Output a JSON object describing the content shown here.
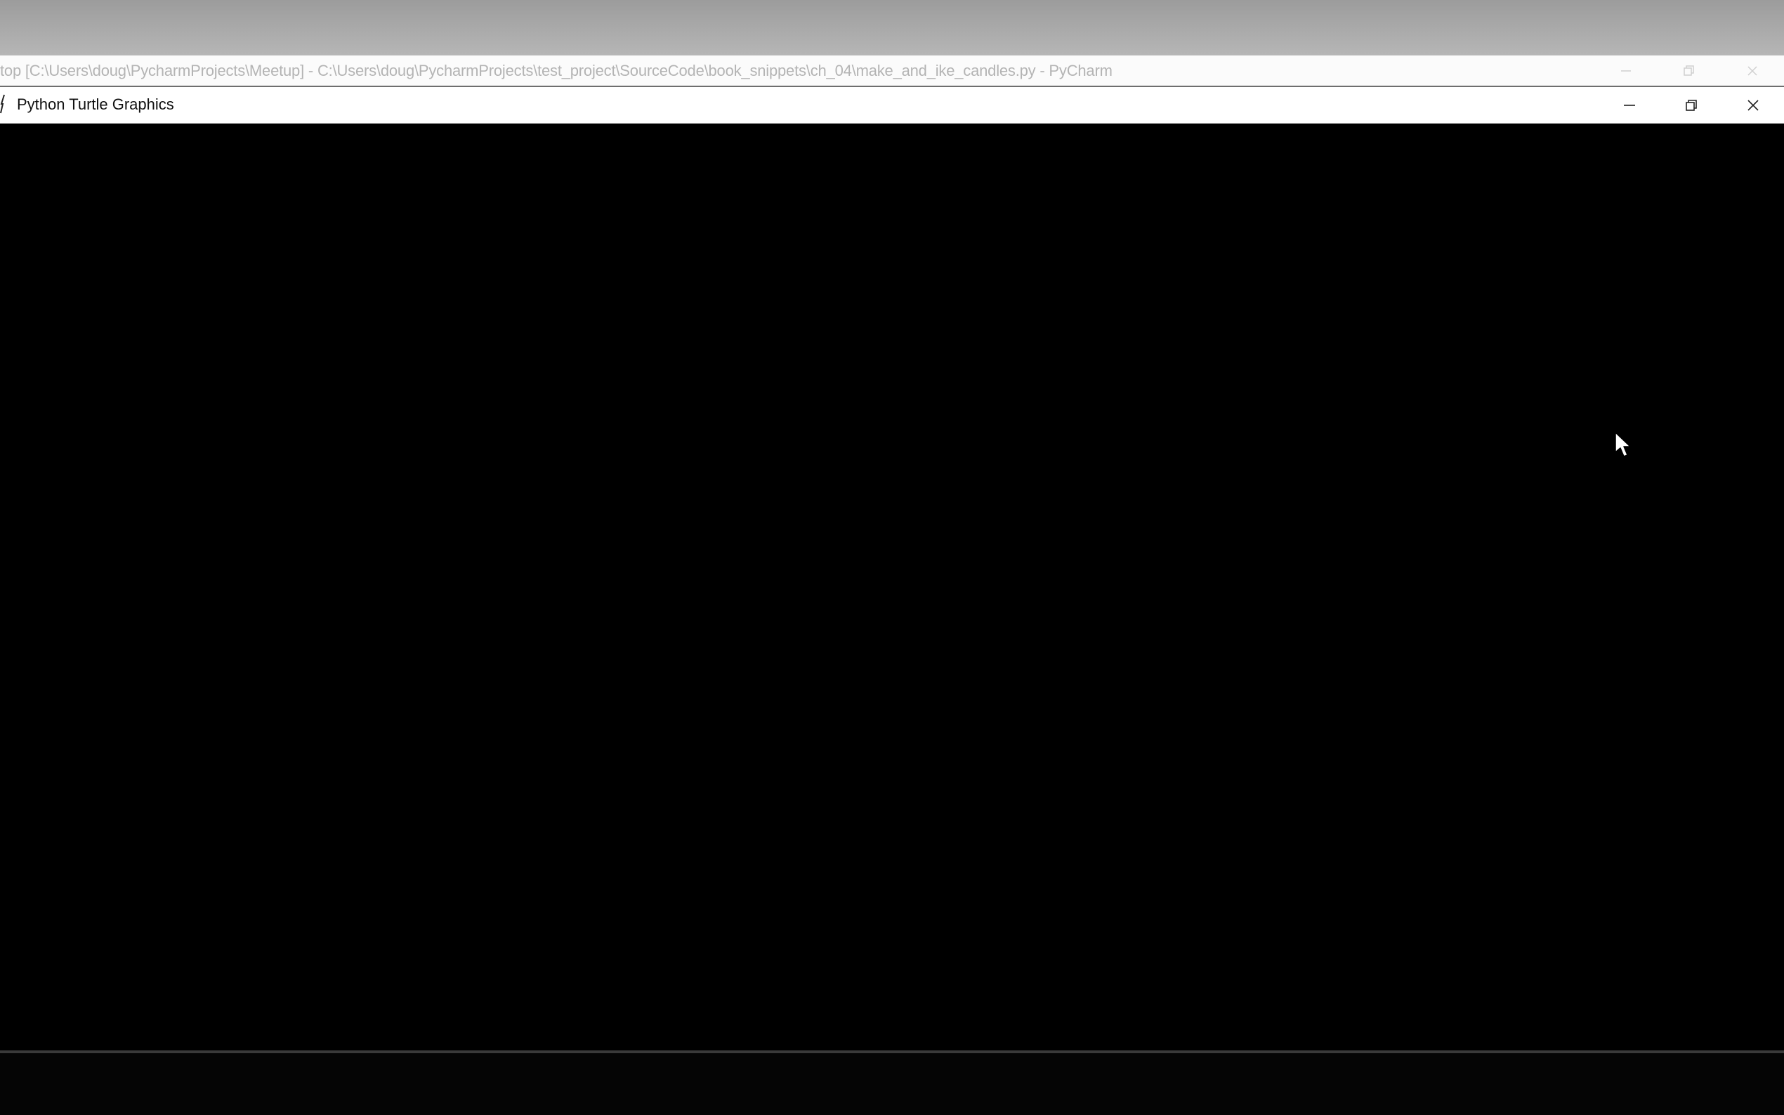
{
  "background_window": {
    "title": "top [C:\\Users\\doug\\PycharmProjects\\Meetup] - C:\\Users\\doug\\PycharmProjects\\test_project\\SourceCode\\book_snippets\\ch_04\\make_and_ike_candles.py - PyCharm",
    "controls": {
      "minimize_icon": "minimize-icon",
      "restore_icon": "restore-icon",
      "close_icon": "close-icon"
    }
  },
  "turtle_window": {
    "title": "Python Turtle Graphics",
    "app_icon": "feather-icon",
    "controls": {
      "minimize_icon": "minimize-icon",
      "restore_icon": "restore-icon",
      "close_icon": "close-icon"
    },
    "canvas_color": "#000000"
  },
  "cursor": {
    "icon": "mouse-pointer-icon"
  }
}
